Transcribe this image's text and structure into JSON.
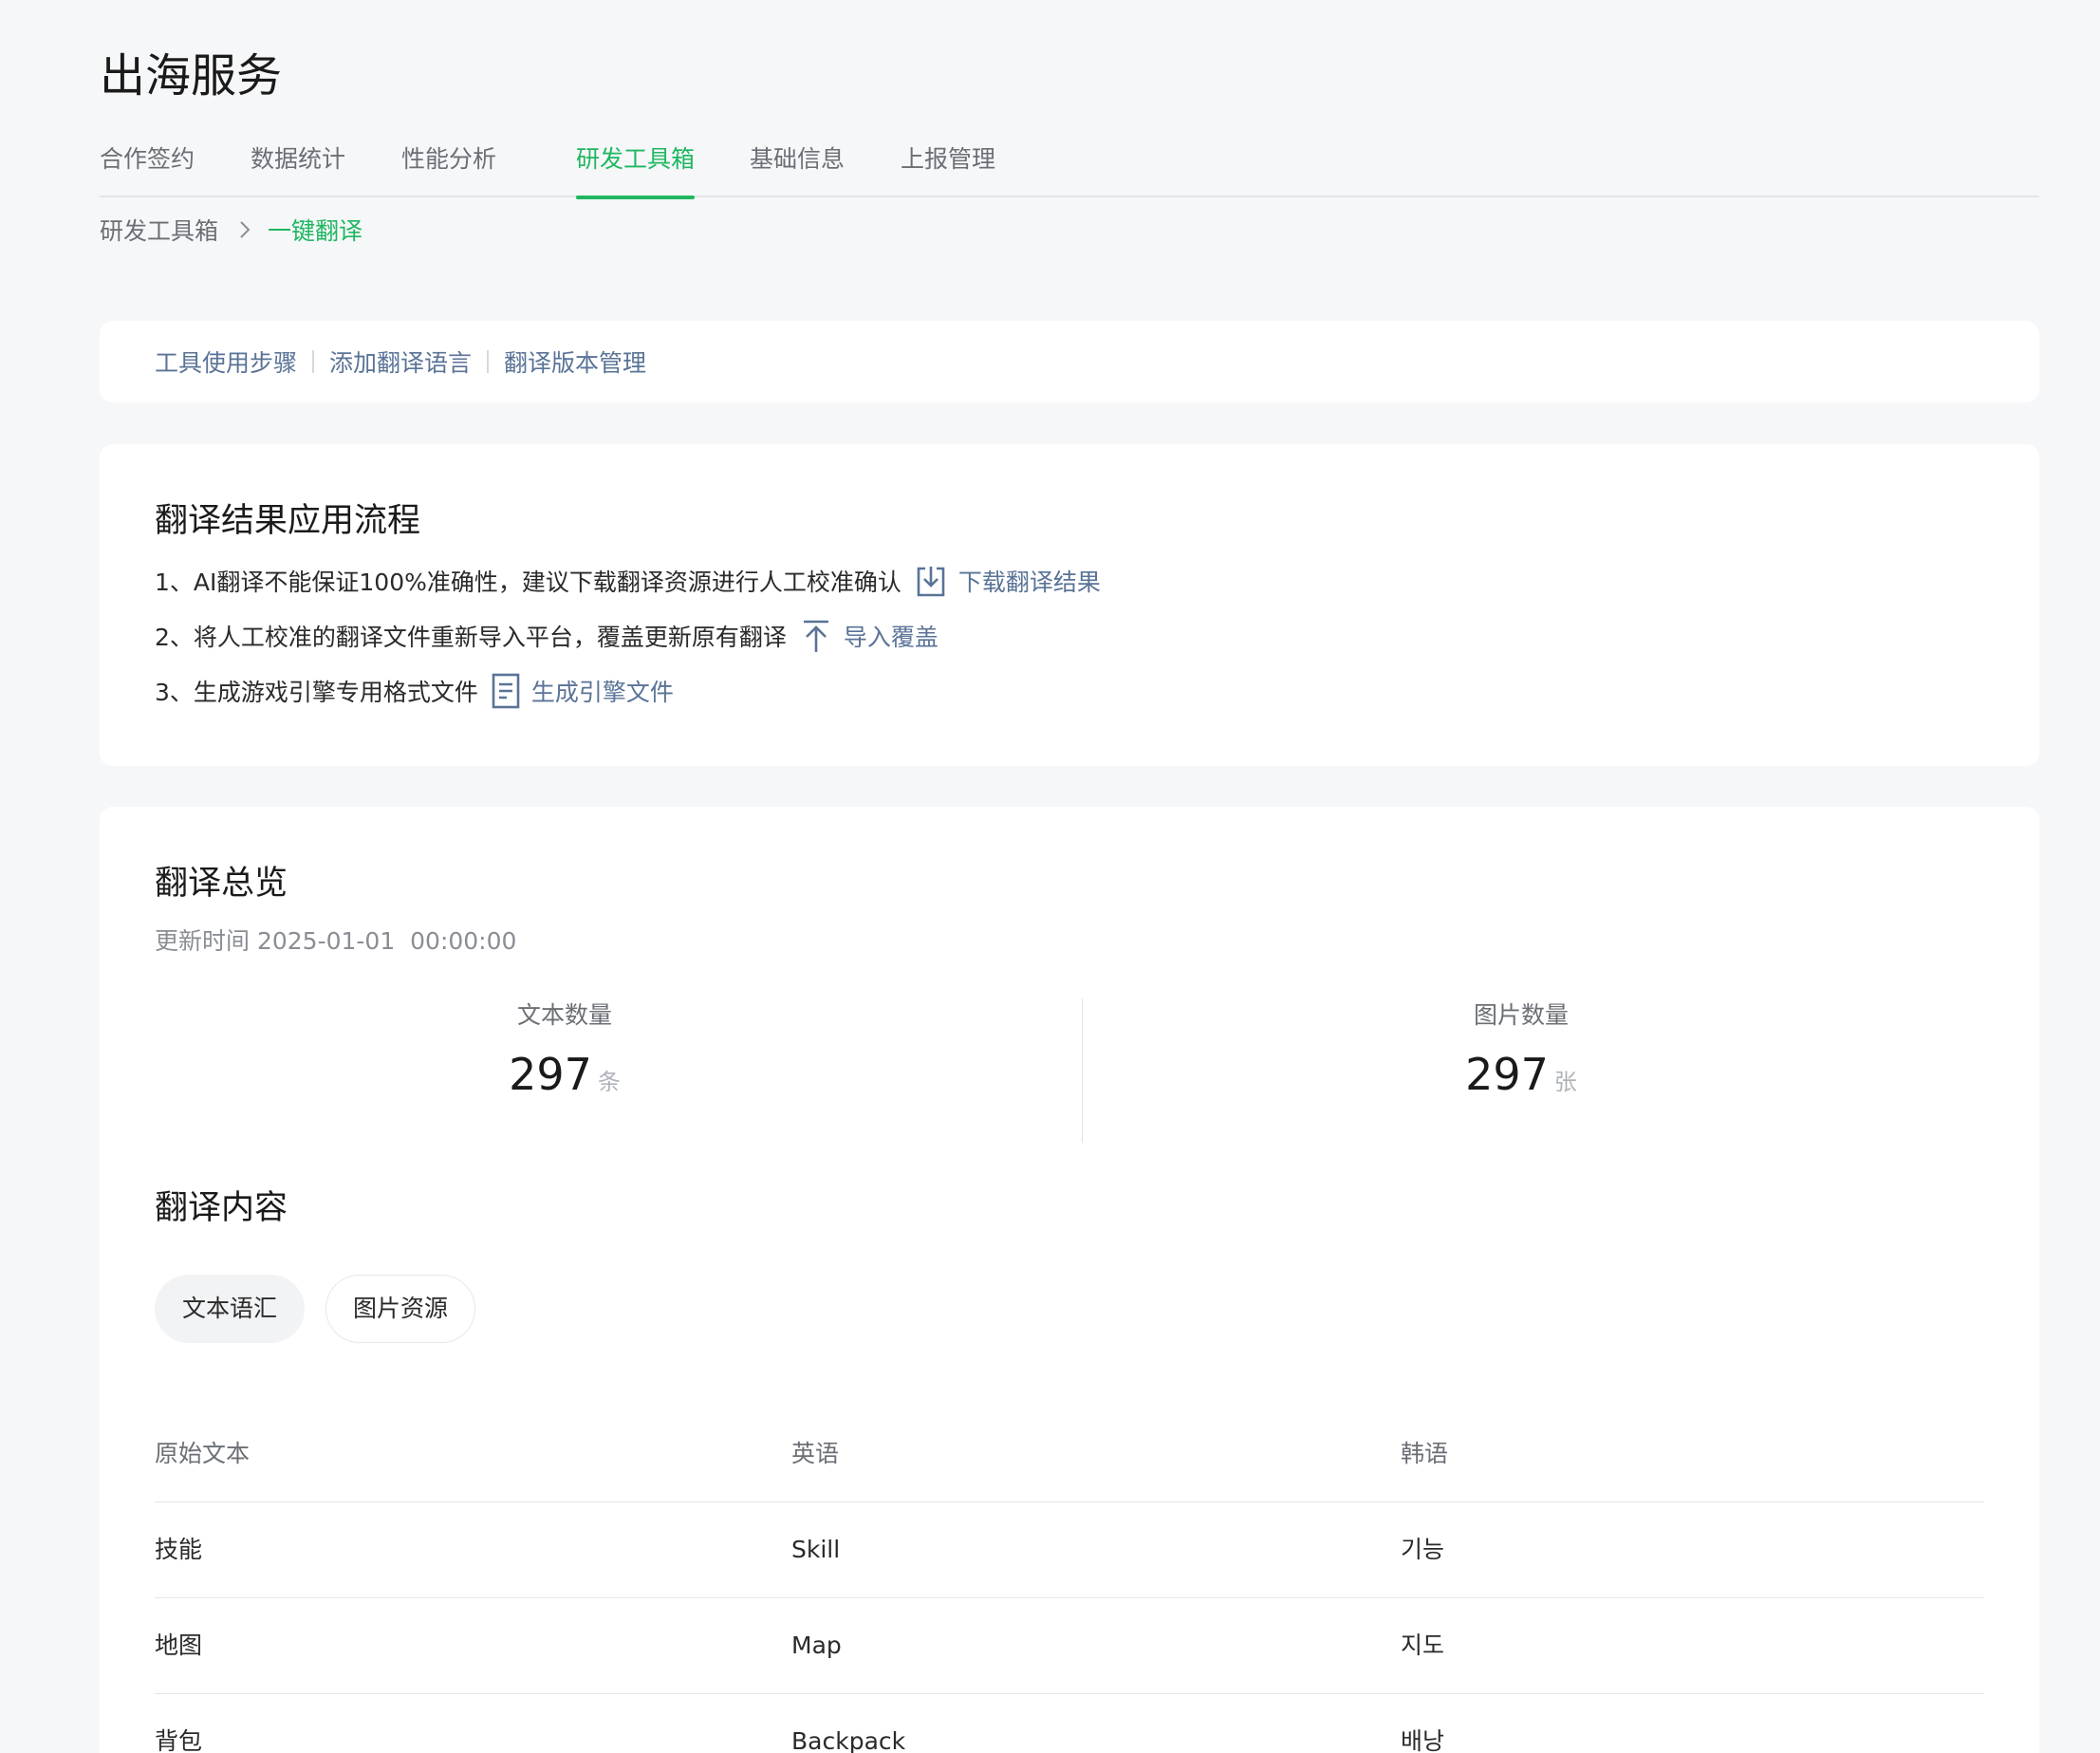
{
  "page_title": "出海服务",
  "tabs": [
    {
      "label": "合作签约"
    },
    {
      "label": "数据统计"
    },
    {
      "label": "性能分析"
    },
    {
      "label": "研发工具箱",
      "active": true
    },
    {
      "label": "基础信息"
    },
    {
      "label": "上报管理"
    }
  ],
  "breadcrumb": {
    "root": "研发工具箱",
    "current": "一键翻译"
  },
  "tool_nav": [
    {
      "label": "工具使用步骤"
    },
    {
      "label": "添加翻译语言"
    },
    {
      "label": "翻译版本管理"
    }
  ],
  "flow": {
    "title": "翻译结果应用流程",
    "steps": [
      {
        "text": "1、AI翻译不能保证100%准确性，建议下载翻译资源进行人工校准确认",
        "action": "下载翻译结果",
        "icon": "download-icon"
      },
      {
        "text": "2、将人工校准的翻译文件重新导入平台，覆盖更新原有翻译",
        "action": "导入覆盖",
        "icon": "upload-icon"
      },
      {
        "text": "3、生成游戏引擎专用格式文件",
        "action": "生成引擎文件",
        "icon": "document-icon"
      }
    ]
  },
  "overview": {
    "title": "翻译总览",
    "update_time": "更新时间 2025-01-01  00:00:00",
    "stats": [
      {
        "label": "文本数量",
        "value": "297",
        "unit": "条"
      },
      {
        "label": "图片数量",
        "value": "297",
        "unit": "张"
      }
    ]
  },
  "content": {
    "title": "翻译内容",
    "pills": [
      {
        "label": "文本语汇",
        "active": true
      },
      {
        "label": "图片资源",
        "active": false
      }
    ],
    "table": {
      "headers": [
        "原始文本",
        "英语",
        "韩语"
      ],
      "rows": [
        [
          "技能",
          "Skill",
          "기능"
        ],
        [
          "地图",
          "Map",
          "지도"
        ],
        [
          "背包",
          "Backpack",
          "배낭"
        ]
      ]
    }
  },
  "colors": {
    "accent": "#1fb760",
    "link": "#5a7397",
    "background": "#f6f7f9"
  }
}
